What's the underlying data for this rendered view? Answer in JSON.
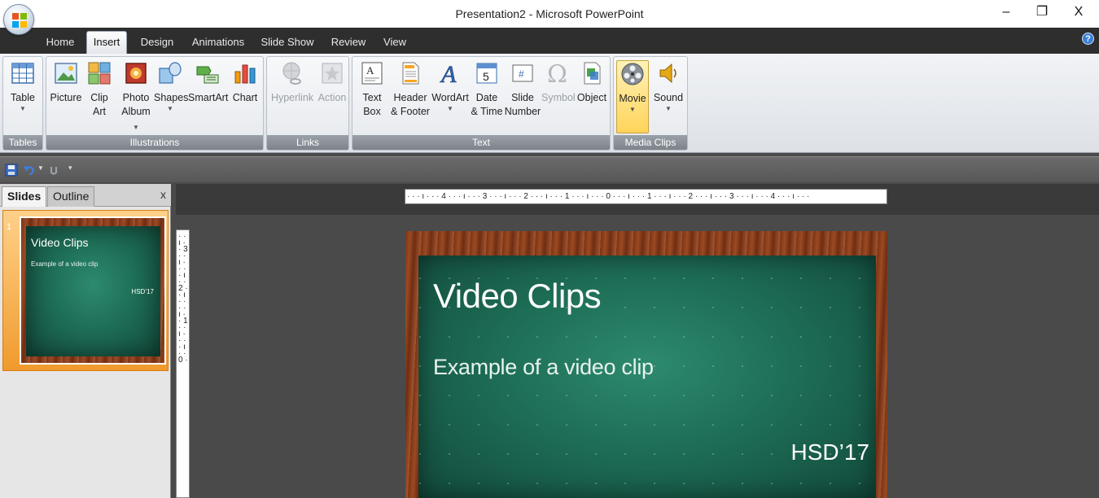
{
  "window": {
    "title": "Presentation2 - Microsoft PowerPoint",
    "minimize": "–",
    "restore": "❐",
    "close": "X"
  },
  "tabs": [
    "Home",
    "Insert",
    "Design",
    "Animations",
    "Slide Show",
    "Review",
    "View"
  ],
  "active_tab": "Insert",
  "help": "?",
  "ribbon": {
    "groups": {
      "tables": "Tables",
      "illustrations": "Illustrations",
      "links": "Links",
      "text": "Text",
      "media": "Media Clips"
    },
    "buttons": {
      "table": "Table",
      "picture": "Picture",
      "clipart_1": "Clip",
      "clipart_2": "Art",
      "photo_1": "Photo",
      "photo_2": "Album",
      "shapes": "Shapes",
      "smartart": "SmartArt",
      "chart": "Chart",
      "hyperlink": "Hyperlink",
      "action": "Action",
      "textbox_1": "Text",
      "textbox_2": "Box",
      "header_1": "Header",
      "header_2": "& Footer",
      "wordart": "WordArt",
      "date_1": "Date",
      "date_2": "& Time",
      "slidenum_1": "Slide",
      "slidenum_2": "Number",
      "symbol": "Symbol",
      "object": "Object",
      "movie": "Movie",
      "sound": "Sound"
    }
  },
  "pane": {
    "slides_tab": "Slides",
    "outline_tab": "Outline",
    "close": "x",
    "thumb_number": "1"
  },
  "ruler_h": "· · · ı · · · 4 · · · ı · · · 3 · · · ı · · · 2 · · · ı · · · 1 · · · ı · · · 0 · · · ı · · · 1 · · · ı · · · 2 · · · ı · · · 3 · · · ı · · · 4 · · · ı · · ·",
  "ruler_v": "· · ı · · 3 · · ı · · · · ı · · 2 · · ı · · · · ı · · 1 · · ı · · · · ı · · 0 ·",
  "slide": {
    "title": "Video Clips",
    "subtitle": "Example of a video clip",
    "tag": "HSD’17"
  },
  "colors": {
    "board": "#1e6e57",
    "frame": "#8a3e1c",
    "selected_button": "#ffd45a",
    "thumb_highlight": "#f09a2d"
  }
}
